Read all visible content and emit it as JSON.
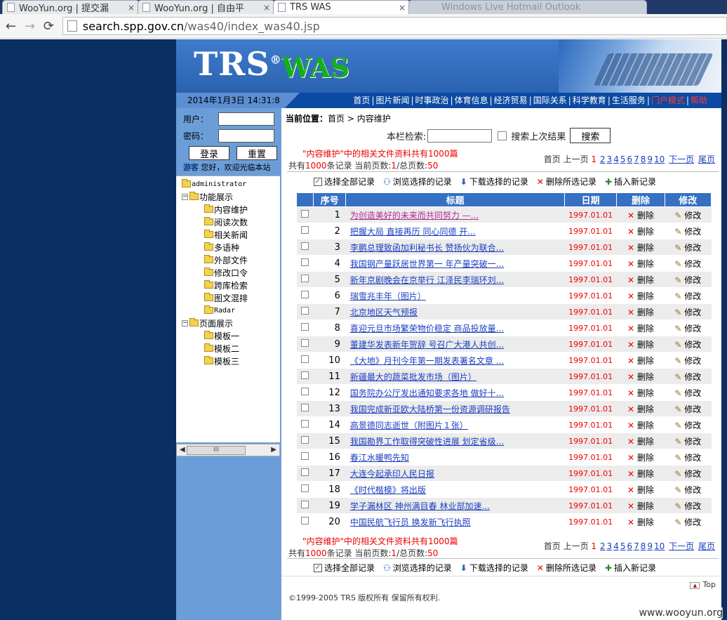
{
  "browser": {
    "tabs": [
      {
        "title": "WooYun.org | 提交漏",
        "close": "×"
      },
      {
        "title": "WooYun.org | 自由平",
        "close": "×"
      },
      {
        "title": "TRS WAS",
        "close": "×"
      },
      {
        "title": "Windows Live Hotmail Outlook",
        "close": ""
      }
    ],
    "url_host": "search.spp.gov.cn",
    "url_path": "/was40/index_was40.jsp"
  },
  "banner": {
    "logo_trs": "TRS",
    "logo_reg": "®",
    "logo_was": "WAS"
  },
  "navbar": {
    "datetime": "2014年1月3日 14:31:8",
    "links": [
      "首页",
      "图片新闻",
      "时事政治",
      "体育信息",
      "经济贸易",
      "国际关系",
      "科学教育",
      "生活服务"
    ],
    "red_links": [
      "门户模式",
      "帮助"
    ]
  },
  "login": {
    "user_label": "用户：",
    "pass_label": "密码：",
    "login_btn": "登录",
    "reset_btn": "重置",
    "guest": "游客",
    "welcome": "您好，欢迎光临本站"
  },
  "tree": {
    "root": "administrator",
    "group1": "功能展示",
    "group1_items": [
      "内容维护",
      "阅读次数",
      "相关新闻",
      "多语种",
      "外部文件",
      "修改口令",
      "跨库检索",
      "图文混排",
      "Radar"
    ],
    "group2": "页面展示",
    "group2_items": [
      "模板一",
      "模板二",
      "模板三"
    ],
    "scroll_thumb": "III"
  },
  "main": {
    "crumb_label": "当前位置：",
    "crumb_path": "首页 > 内容维护",
    "search_label": "本栏检索:",
    "search_last": "搜索上次结果",
    "search_btn": "搜索",
    "summary_line1": "\"内容维护\"中的相关文件资料共有1000篇",
    "summary_total_pre": "共有",
    "summary_total": "1000",
    "summary_total_post": "条记录 当前页数:",
    "summary_page": "1",
    "summary_pages_pre": "/总页数:",
    "summary_pages": "50",
    "pager": {
      "first": "首页",
      "prev": "上一页",
      "current": "1",
      "pages": [
        "2",
        "3",
        "4",
        "5",
        "6",
        "7",
        "8",
        "9",
        "10"
      ],
      "next": "下一页",
      "last": "尾页"
    },
    "actions": [
      "选择全部记录",
      "浏览选择的记录",
      "下载选择的记录",
      "删除所选记录",
      "插入新记录"
    ],
    "columns": [
      "序号",
      "标题",
      "日期",
      "删除",
      "修改"
    ],
    "rows": [
      {
        "n": "1",
        "title": "为创造美好的未来而共同努力 —...",
        "date": "1997.01.01"
      },
      {
        "n": "2",
        "title": "把握大局 直接再历 同心同德 开...",
        "date": "1997.01.01"
      },
      {
        "n": "3",
        "title": "李鹏总理致函加利秘书长 赞扬伙为联合...",
        "date": "1997.01.01"
      },
      {
        "n": "4",
        "title": "我国钢产量跃居世界第一 年产量突破一...",
        "date": "1997.01.01"
      },
      {
        "n": "5",
        "title": "新年京剧晚会在京举行 江泽民李瑞环刘...",
        "date": "1997.01.01"
      },
      {
        "n": "6",
        "title": "瑞雪兆丰年（图片）",
        "date": "1997.01.01"
      },
      {
        "n": "7",
        "title": "北京地区天气预报",
        "date": "1997.01.01"
      },
      {
        "n": "8",
        "title": "喜迎元旦市场繁荣物价稳定 商品投放量...",
        "date": "1997.01.01"
      },
      {
        "n": "9",
        "title": "董建华发表新年贺辞 号召广大港人共创...",
        "date": "1997.01.01"
      },
      {
        "n": "10",
        "title": "《大地》月刊今年第一期发表署名文章 ...",
        "date": "1997.01.01"
      },
      {
        "n": "11",
        "title": "新疆最大的蔬菜批发市场（图片）",
        "date": "1997.01.01"
      },
      {
        "n": "12",
        "title": "国务院办公厅发出通知要求各地 做好十...",
        "date": "1997.01.01"
      },
      {
        "n": "13",
        "title": "我国完成新亚欧大陆桥第一份资源调研报告",
        "date": "1997.01.01"
      },
      {
        "n": "14",
        "title": "高景德同志逝世（附图片１张）",
        "date": "1997.01.01"
      },
      {
        "n": "15",
        "title": "我国勘界工作取得突破性进展 划定省级...",
        "date": "1997.01.01"
      },
      {
        "n": "16",
        "title": "春江水暖鸭先知",
        "date": "1997.01.01"
      },
      {
        "n": "17",
        "title": "大连今起承印人民日报",
        "date": "1997.01.01"
      },
      {
        "n": "18",
        "title": "《时代楷模》将出版",
        "date": "1997.01.01"
      },
      {
        "n": "19",
        "title": "学子漏林区 神州满目春 林业部加速...",
        "date": "1997.01.01"
      },
      {
        "n": "20",
        "title": "中国民航飞行员 换发新飞行执照",
        "date": "1997.01.01"
      }
    ],
    "del_label": "删除",
    "edit_label": "修改",
    "top": "Top",
    "copyright": "©1999-2005 TRS 版权所有 保留所有权利."
  },
  "watermark": "www.wooyun.org"
}
